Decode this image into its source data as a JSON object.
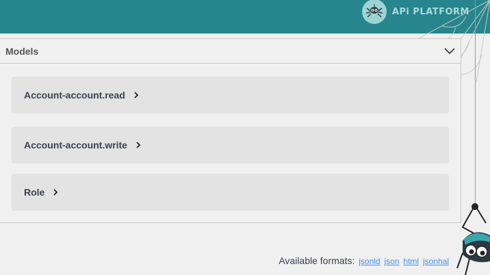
{
  "header": {
    "logo_text": "APi PLATFORM",
    "logo_icon": "spider-logo-icon",
    "bg_color": "#26858d"
  },
  "models": {
    "title": "Models",
    "toggle_icon": "chevron-down-icon",
    "items": [
      {
        "label": "Account-account.read",
        "icon": "chevron-right-icon"
      },
      {
        "label": "Account-account.write",
        "icon": "chevron-right-icon"
      },
      {
        "label": "Role",
        "icon": "chevron-right-icon"
      }
    ]
  },
  "footer": {
    "formats_label": "Available formats:",
    "formats": [
      "jsonld",
      "json",
      "html",
      "jsonhal"
    ],
    "link_color": "#4990e2"
  }
}
